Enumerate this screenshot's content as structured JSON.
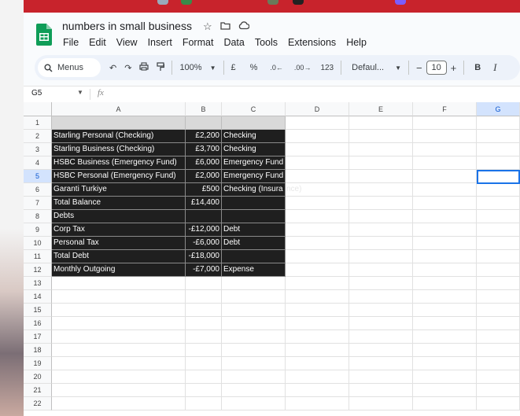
{
  "document": {
    "title": "numbers in small business",
    "menu": [
      "File",
      "Edit",
      "View",
      "Insert",
      "Format",
      "Data",
      "Tools",
      "Extensions",
      "Help"
    ]
  },
  "toolbar": {
    "search_label": "Menus",
    "zoom": "100%",
    "currency": "£",
    "percent": "%",
    "dec_decrease": ".0",
    "dec_increase": ".00",
    "number_format": "123",
    "font": "Defaul...",
    "font_size": "10",
    "minus": "−",
    "plus": "+",
    "bold": "B",
    "italic": "I"
  },
  "formula_bar": {
    "name_box": "G5",
    "fx": "fx"
  },
  "columns": [
    "A",
    "B",
    "C",
    "D",
    "E",
    "F",
    "G"
  ],
  "rows": [
    "1",
    "2",
    "3",
    "4",
    "5",
    "6",
    "7",
    "8",
    "9",
    "10",
    "11",
    "12",
    "13",
    "14",
    "15",
    "16",
    "17",
    "18",
    "19",
    "20",
    "21",
    "22"
  ],
  "cells": [
    {
      "a": "",
      "b": "",
      "c": ""
    },
    {
      "a": "Starling Personal (Checking)",
      "b": "£2,200",
      "c": "Checking"
    },
    {
      "a": "Starling Business (Checking)",
      "b": "£3,700",
      "c": "Checking"
    },
    {
      "a": "HSBC Business (Emergency Fund)",
      "b": "£6,000",
      "c": "Emergency Fund"
    },
    {
      "a": "HSBC Personal (Emergency Fund)",
      "b": "£2,000",
      "c": "Emergency Fund"
    },
    {
      "a": "Garanti Turkiye",
      "b": "£500",
      "c": "Checking (Insura",
      "c_tail": "nce)"
    },
    {
      "a": "Total Balance",
      "b": "£14,400",
      "c": ""
    },
    {
      "a": "Debts",
      "b": "",
      "c": ""
    },
    {
      "a": "Corp Tax",
      "b": "-£12,000",
      "c": "Debt"
    },
    {
      "a": "Personal Tax",
      "b": "-£6,000",
      "c": "Debt"
    },
    {
      "a": "Total Debt",
      "b": "-£18,000",
      "c": ""
    },
    {
      "a": "Monthly Outgoing",
      "b": "-£7,000",
      "c": "Expense"
    }
  ]
}
